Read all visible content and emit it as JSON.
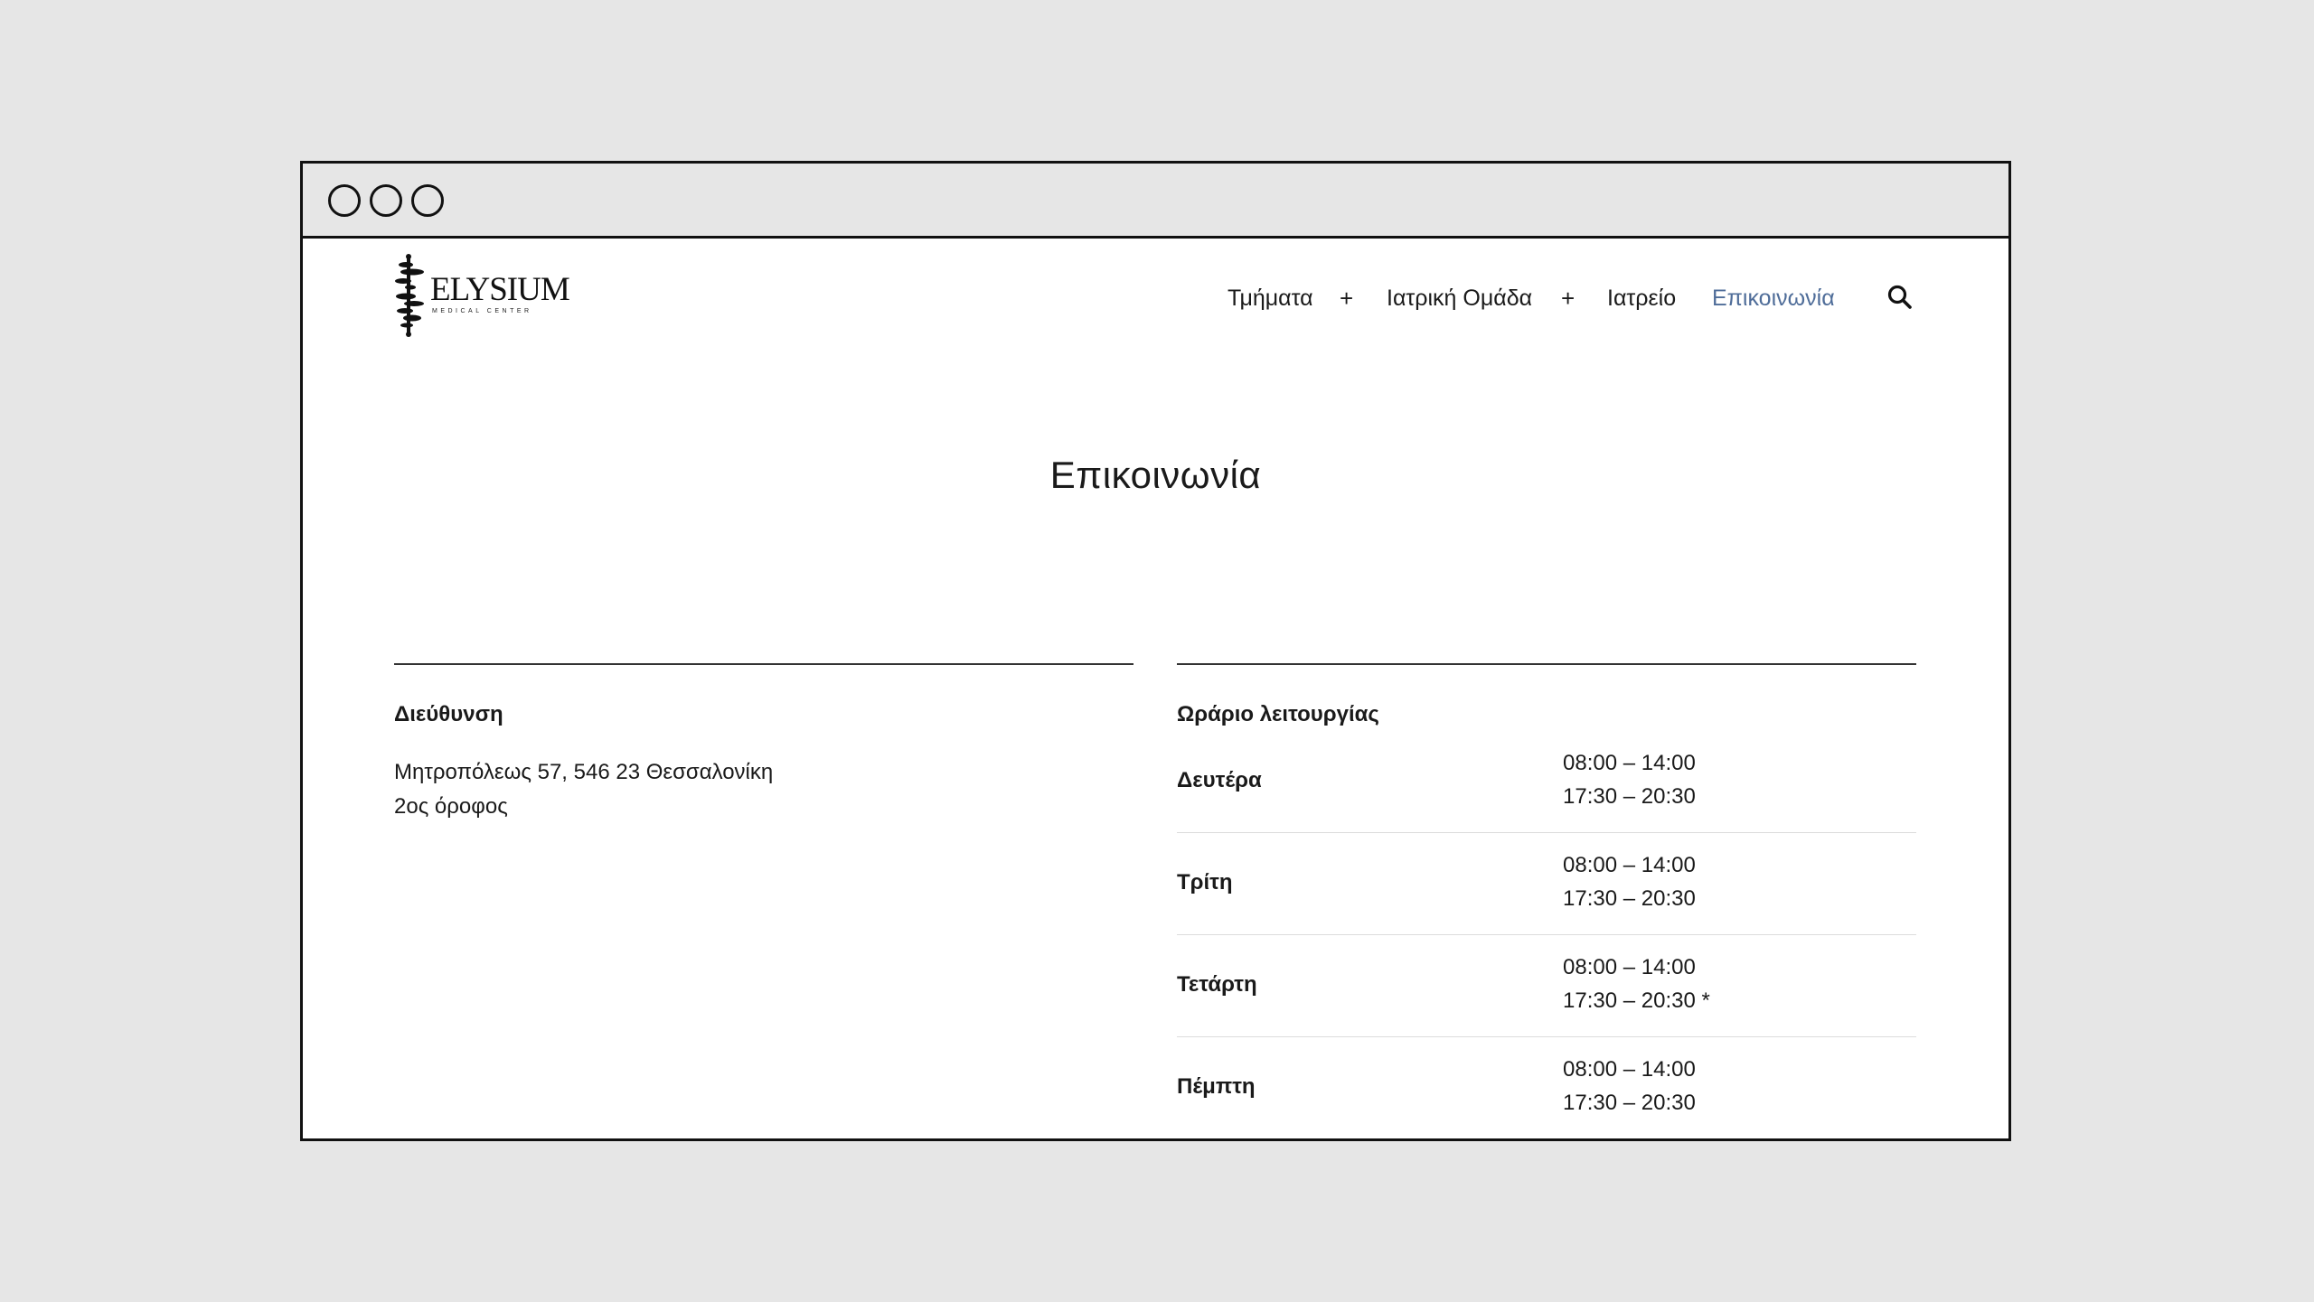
{
  "brand": {
    "name": "ELYSIUM",
    "subtitle": "MEDICAL CENTER"
  },
  "nav": {
    "items": [
      {
        "label": "Τμήματα"
      },
      {
        "label": "Ιατρική Ομάδα"
      },
      {
        "label": "Ιατρείο"
      },
      {
        "label": "Επικοινωνία",
        "active": true
      }
    ],
    "expand_symbol": "+",
    "search_icon": "search-icon",
    "active_color": "#4f6d99"
  },
  "page": {
    "title": "Επικοινωνία"
  },
  "address": {
    "heading": "Διεύθυνση",
    "line1": "Μητροπόλεως 57, 546 23 Θεσσαλονίκη",
    "line2": "2ος όροφος"
  },
  "hours": {
    "heading": "Ωράριο λειτουργίας",
    "rows": [
      {
        "day": "Δευτέρα",
        "morning": "08:00 – 14:00",
        "evening": "17:30 – 20:30"
      },
      {
        "day": "Τρίτη",
        "morning": "08:00 – 14:00",
        "evening": "17:30 – 20:30"
      },
      {
        "day": "Τετάρτη",
        "morning": "08:00 – 14:00",
        "evening": "17:30 – 20:30 *"
      },
      {
        "day": "Πέμπτη",
        "morning": "08:00 – 14:00",
        "evening": "17:30 – 20:30"
      }
    ]
  }
}
